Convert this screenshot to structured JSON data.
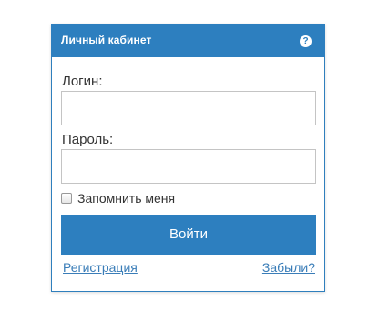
{
  "panel": {
    "title": "Личный кабинет",
    "help_symbol": "?",
    "help_icon": "question-circle-icon"
  },
  "form": {
    "login_label": "Логин:",
    "login_value": "",
    "password_label": "Пароль:",
    "password_value": "",
    "remember_label": "Запомнить меня",
    "remember_checked": false,
    "submit_label": "Войти"
  },
  "links": {
    "register": "Регистрация",
    "forgot": "Забыли?"
  },
  "colors": {
    "accent": "#2d7fbf",
    "link": "#3a7db8",
    "text": "#333333"
  }
}
